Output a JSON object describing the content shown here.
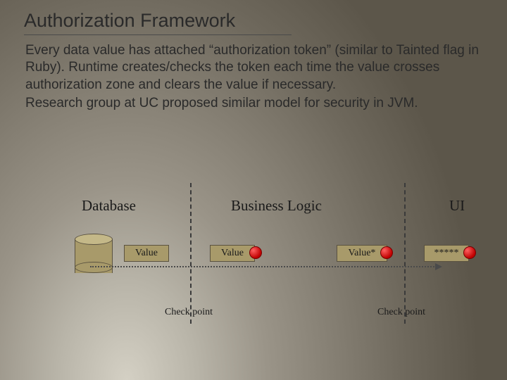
{
  "title": "Authorization Framework",
  "body": {
    "p1": "Every data value has attached “authorization token”  (similar to Tainted flag in Ruby). Runtime creates/checks the token each time the value crosses authorization zone and clears the value if necessary.",
    "p2": "Research group at UC proposed similar model for security in JVM."
  },
  "zones": {
    "database": "Database",
    "business": "Business Logic",
    "ui": "UI"
  },
  "boxes": {
    "v1": "Value",
    "v2": "Value",
    "v3": "Value*",
    "v4": "*****"
  },
  "checkpoints": {
    "cp1": "Check point",
    "cp2": "Check point"
  },
  "colors": {
    "box_fill": "#a89a6a",
    "dot_fill": "#c00000"
  }
}
